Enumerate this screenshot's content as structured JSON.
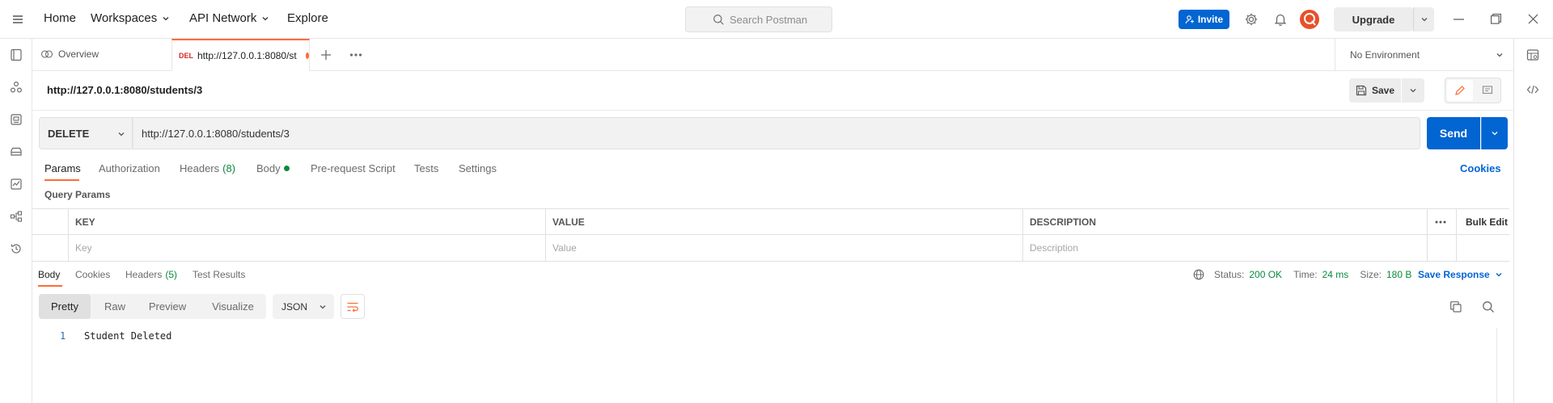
{
  "topbar": {
    "home": "Home",
    "workspaces": "Workspaces",
    "api_network": "API Network",
    "explore": "Explore",
    "search_placeholder": "Search Postman",
    "invite": "Invite",
    "upgrade": "Upgrade"
  },
  "tabs": {
    "overview": "Overview",
    "active_method": "DEL",
    "active_title": "http://127.0.0.1:8080/st",
    "environment": "No Environment"
  },
  "request": {
    "title": "http://127.0.0.1:8080/students/3",
    "save": "Save",
    "method": "DELETE",
    "url": "http://127.0.0.1:8080/students/3",
    "send": "Send"
  },
  "request_tabs": {
    "params": "Params",
    "authorization": "Authorization",
    "headers": "Headers",
    "headers_count": "(8)",
    "body": "Body",
    "prerequest": "Pre-request Script",
    "tests": "Tests",
    "settings": "Settings",
    "cookies": "Cookies"
  },
  "query_params": {
    "label": "Query Params",
    "headers": {
      "key": "KEY",
      "value": "VALUE",
      "description": "DESCRIPTION",
      "bulk_edit": "Bulk Edit"
    },
    "placeholders": {
      "key": "Key",
      "value": "Value",
      "description": "Description"
    }
  },
  "response": {
    "tabs": {
      "body": "Body",
      "cookies": "Cookies",
      "headers": "Headers",
      "headers_count": "(5)",
      "test_results": "Test Results"
    },
    "status_label": "Status:",
    "status": "200 OK",
    "time_label": "Time:",
    "time": "24 ms",
    "size_label": "Size:",
    "size": "180 B",
    "save_response": "Save Response",
    "formats": [
      "Pretty",
      "Raw",
      "Preview",
      "Visualize"
    ],
    "language": "JSON",
    "line_number": "1",
    "body_text": "Student Deleted"
  },
  "colors": {
    "accent": "#ff6c37",
    "primary": "#0265d2",
    "success": "#0b8a3e",
    "delete_method": "#d12c2c"
  }
}
